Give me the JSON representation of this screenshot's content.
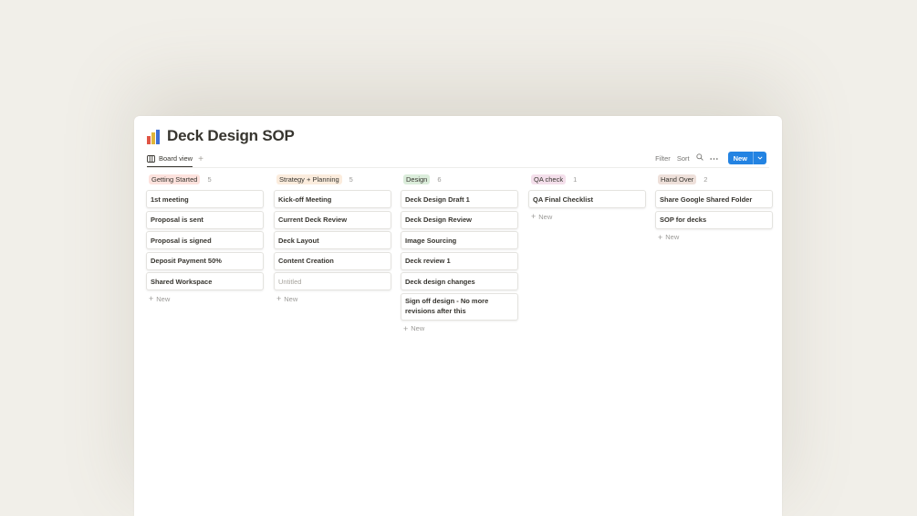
{
  "page": {
    "title": "Deck Design SOP",
    "icon": "bar-chart-icon",
    "icon_colors": [
      "#e05545",
      "#e0b53a",
      "#3f6fd6"
    ]
  },
  "tabs": [
    {
      "label": "Board view",
      "icon": "board-view-icon",
      "active": true
    }
  ],
  "add_tab": "+",
  "toolbar": {
    "filter": "Filter",
    "sort": "Sort",
    "search_icon": "search-icon",
    "more_icon": "more-dots-icon",
    "new_label": "New",
    "new_dropdown_icon": "chevron-down-icon",
    "accent": "#2383e2"
  },
  "board": {
    "new_label": "New",
    "columns": [
      {
        "name": "Getting Started",
        "count": "5",
        "color": "#fde2dd",
        "cards": [
          "1st meeting",
          "Proposal is sent",
          "Proposal is signed",
          "Deposit Payment 50%",
          "Shared Workspace"
        ]
      },
      {
        "name": "Strategy + Planning",
        "count": "5",
        "color": "#fbecdd",
        "cards": [
          "Kick-off Meeting",
          "Current Deck Review",
          "Deck Layout",
          "Content Creation",
          "Untitled"
        ],
        "placeholder_index": 4
      },
      {
        "name": "Design",
        "count": "6",
        "color": "#dbeddb",
        "cards": [
          "Deck Design Draft 1",
          "Deck Design Review",
          "Image Sourcing",
          "Deck review 1",
          "Deck design changes",
          "Sign off design - No more revisions after this"
        ]
      },
      {
        "name": "QA check",
        "count": "1",
        "color": "#f4dfeb",
        "cards": [
          "QA Final Checklist"
        ]
      },
      {
        "name": "Hand Over",
        "count": "2",
        "color": "#eee0da",
        "cards": [
          "Share Google Shared Folder",
          "SOP for decks"
        ]
      }
    ]
  }
}
